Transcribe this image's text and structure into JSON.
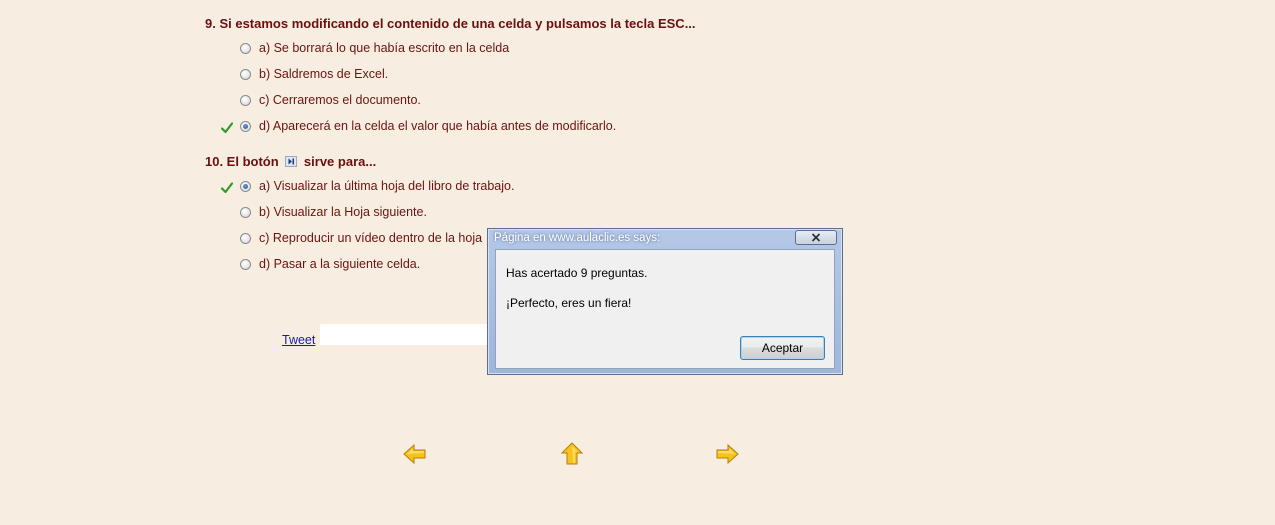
{
  "questions": [
    {
      "title": "9. Si estamos modificando el contenido de una celda y pulsamos la tecla ESC...",
      "options": [
        {
          "label": "a) Se borrará lo que había escrito en la celda",
          "checked": false
        },
        {
          "label": "b) Saldremos de Excel.",
          "checked": false
        },
        {
          "label": "c) Cerraremos el documento.",
          "checked": false
        },
        {
          "label": "d) Aparecerá en la celda el valor que había antes de modificarlo.",
          "checked": true,
          "correct_mark": true
        }
      ]
    },
    {
      "title_before_icon": "10. El botón",
      "title_icon": "last-sheet-navigation-icon",
      "title_after_icon": "sirve para...",
      "options": [
        {
          "label": "a) Visualizar la última hoja del libro de trabajo.",
          "checked": true,
          "correct_mark": true
        },
        {
          "label": "b) Visualizar la Hoja siguiente.",
          "checked": false
        },
        {
          "label": "c) Reproducir un vídeo dentro de la hoja",
          "checked": false
        },
        {
          "label": "d) Pasar a la siguiente celda.",
          "checked": false
        }
      ]
    }
  ],
  "tweet_label": "Tweet",
  "navigation": {
    "prev_icon": "arrow-left-icon",
    "up_icon": "arrow-up-icon",
    "next_icon": "arrow-right-icon"
  },
  "dialog": {
    "title": "Página en www.aulaclic.es says:",
    "message_line1": "Has acertado 9 preguntas.",
    "message_line2": "¡Perfecto, eres un fiera!",
    "ok_label": "Aceptar"
  },
  "colors": {
    "background": "#f7ede0",
    "text": "#6b1414",
    "check": "#2e9b2e",
    "arrow_fill": "#f6c31a"
  }
}
